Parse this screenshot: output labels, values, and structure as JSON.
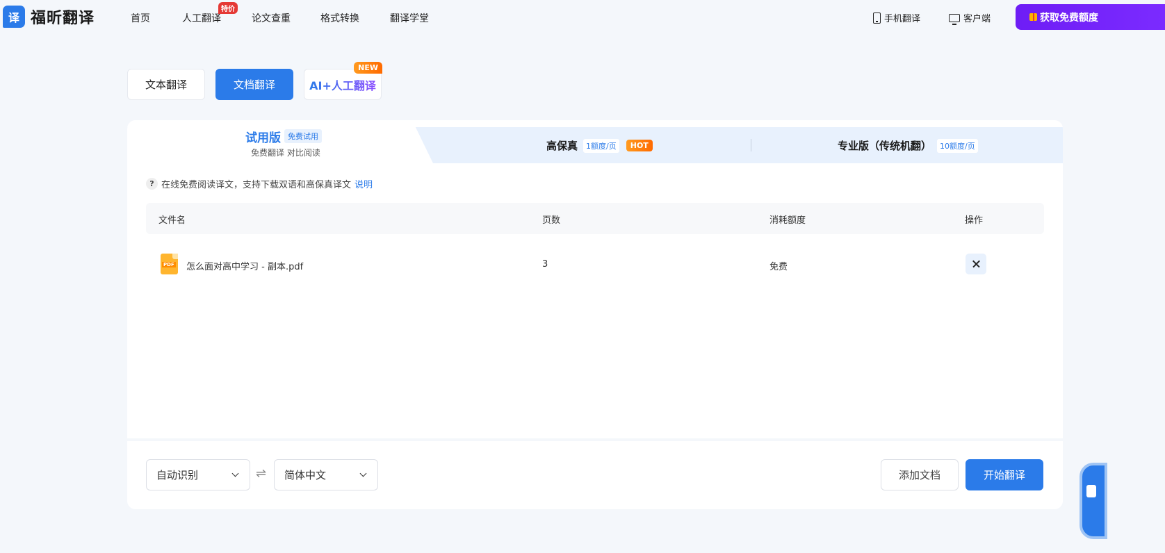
{
  "brand": {
    "logo_char": "译",
    "name": "福昕翻译"
  },
  "nav": {
    "items": [
      {
        "label": "首页"
      },
      {
        "label": "人工翻译",
        "badge": "特价"
      },
      {
        "label": "论文查重"
      },
      {
        "label": "格式转换"
      },
      {
        "label": "翻译学堂"
      }
    ],
    "mobile": "手机翻译",
    "client": "客户端",
    "promo": "获取免费额度"
  },
  "mode_tabs": {
    "text": "文本翻译",
    "document": "文档翻译",
    "ai": "AI+人工翻译",
    "new_badge": "NEW"
  },
  "versions": {
    "trial": {
      "title": "试用版",
      "badge": "免费试用",
      "sub": "免费翻译 对比阅读"
    },
    "hifi": {
      "title": "高保真",
      "badge": "1额度/页",
      "hot": "HOT"
    },
    "pro": {
      "title": "专业版（传统机翻）",
      "badge": "10额度/页"
    }
  },
  "hint": {
    "icon": "?",
    "text": "在线免费阅读译文，支持下载双语和高保真译文",
    "link": "说明"
  },
  "table": {
    "headers": [
      "文件名",
      "页数",
      "消耗额度",
      "操作"
    ],
    "rows": [
      {
        "icon_label": "PDF",
        "filename": "怎么面对高中学习 - 副本.pdf",
        "pages": "3",
        "cost": "免费"
      }
    ]
  },
  "footer": {
    "source_lang": "自动识别",
    "swap": "⇌",
    "target_lang": "简体中文",
    "add_doc": "添加文档",
    "start": "开始翻译"
  },
  "colors": {
    "primary": "#2b7be9",
    "promo": "#6e1df5",
    "hot": "#ff6a00",
    "badge_red": "#e53935"
  }
}
